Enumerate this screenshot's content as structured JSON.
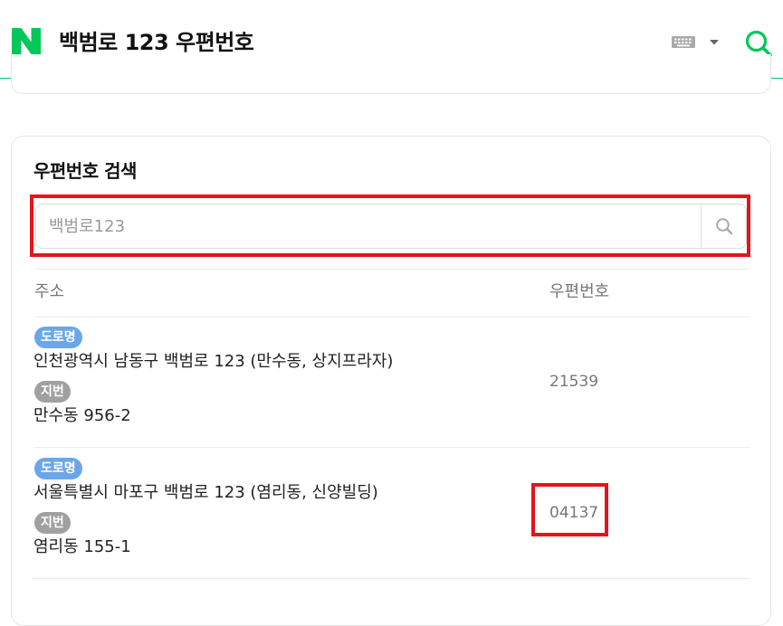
{
  "header": {
    "logo_letter": "N",
    "title": "백범로 123 우편번호",
    "brand_color": "#03c75a",
    "icons": [
      "naver-logo",
      "keyboard-icon",
      "chevron-down-icon",
      "search-icon"
    ]
  },
  "search_card": {
    "title": "우편번호 검색",
    "input_value": "",
    "input_placeholder": "백범로123",
    "search_icon": "search-icon",
    "highlight_color": "#e3141e"
  },
  "table": {
    "headers": {
      "address": "주소",
      "zip": "우편번호"
    },
    "rows": [
      {
        "road_badge": "도로명",
        "road_address": "인천광역시 남동구 백범로 123 (만수동, 상지프라자)",
        "lot_badge": "지번",
        "lot_address": "만수동 956-2",
        "zip": "21539"
      },
      {
        "road_badge": "도로명",
        "road_address": "서울특별시 마포구 백범로 123 (염리동, 신양빌딩)",
        "lot_badge": "지번",
        "lot_address": "염리동 155-1",
        "zip": "04137"
      }
    ]
  }
}
